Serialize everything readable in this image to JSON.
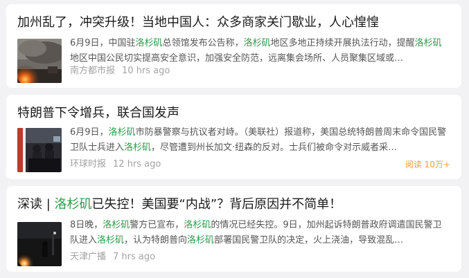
{
  "feed": {
    "items": [
      {
        "title": "加州乱了，冲突升级！当地中国人：众多商家关门歇业，人心惶惶",
        "snippet": [
          {
            "t": "6月9日，中国驻"
          },
          {
            "t": "洛杉矶",
            "hl": true
          },
          {
            "t": "总领馆发布公告称，"
          },
          {
            "t": "洛杉矶",
            "hl": true
          },
          {
            "t": "地区多地正持续开展执法行动，提醒"
          },
          {
            "t": "洛杉矶",
            "hl": true
          },
          {
            "t": "地区中国公民切实提高安全意识，加强安全防范，远离集会场所、人员聚集区域或…"
          }
        ],
        "source": "南方都市报",
        "time": "10 hrs ago",
        "thumb_icon": "fire-smoke-photo"
      },
      {
        "title": "特朗普下令增兵，联合国发声",
        "snippet": [
          {
            "t": "6月9日，"
          },
          {
            "t": "洛杉矶",
            "hl": true
          },
          {
            "t": "市防暴警察与抗议者对峙。（美联社）报道称，美国总统特朗普周末命令国民警卫队士兵进入"
          },
          {
            "t": "洛杉矶",
            "hl": true
          },
          {
            "t": "，尽管遭到州长加文·纽森的反对。士兵们被命令对示威者采…"
          }
        ],
        "source": "环球时报",
        "time": "12 hrs ago",
        "reads": "阅读 10万+",
        "thumb_icon": "riot-police-photo"
      },
      {
        "title_parts": [
          {
            "t": "深读 | "
          },
          {
            "t": "洛杉矶",
            "hl": true
          },
          {
            "t": "已失控！美国要“内战”？背后原因并不简单！"
          }
        ],
        "snippet": [
          {
            "t": "8日晚，"
          },
          {
            "t": "洛杉矶",
            "hl": true
          },
          {
            "t": "警方已宣布，"
          },
          {
            "t": "洛杉矶",
            "hl": true
          },
          {
            "t": "的情况已经失控。9日，加州起诉特朗普政府调遣国民警卫队进入"
          },
          {
            "t": "洛杉矶",
            "hl": true
          },
          {
            "t": "，认为特朗普向"
          },
          {
            "t": "洛杉矶",
            "hl": true
          },
          {
            "t": "部署国民警卫队的决定，火上浇油，导致混乱…"
          }
        ],
        "source": "天津广播",
        "time": "7 hrs ago",
        "thumb_icon": "night-fire-photo"
      }
    ]
  },
  "colors": {
    "highlight": "#2e9a48",
    "reads": "#f0a030",
    "meta": "#a3a3a3",
    "background": "#f2f2f4"
  }
}
